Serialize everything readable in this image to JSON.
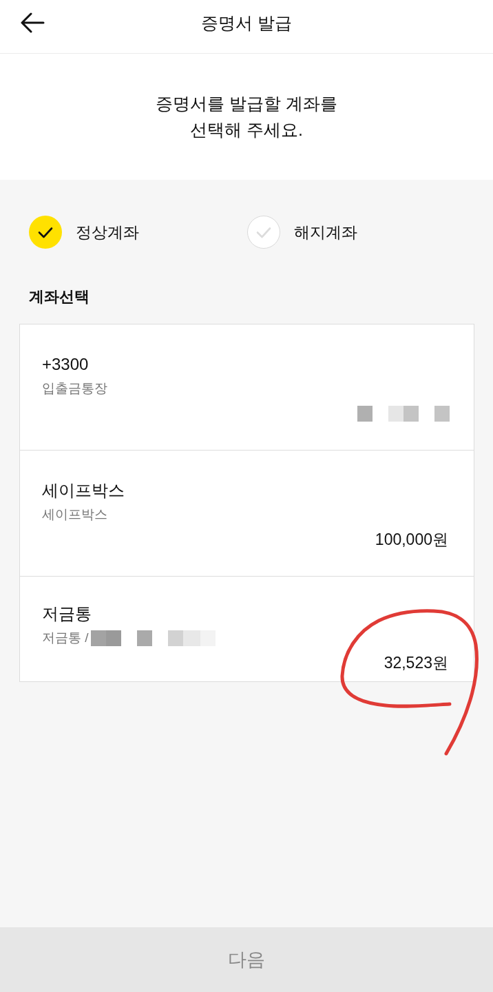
{
  "header": {
    "title": "증명서 발급"
  },
  "instruction": "증명서를 발급할 계좌를\n선택해 주세요.",
  "account_filter": [
    {
      "label": "정상계좌",
      "selected": true
    },
    {
      "label": "해지계좌",
      "selected": false
    }
  ],
  "section_label": "계좌선택",
  "accounts": [
    {
      "name": "+3300",
      "subtitle": "입출금통장",
      "subtitle_masked": false,
      "amount_masked": true,
      "highlighted": false
    },
    {
      "name": "세이프박스",
      "subtitle": "세이프박스",
      "subtitle_masked": false,
      "amount": "100,000원",
      "amount_masked": false,
      "highlighted": false
    },
    {
      "name": "저금통",
      "subtitle": "저금통 /",
      "subtitle_masked": true,
      "amount": "32,523원",
      "amount_masked": false,
      "highlighted": true
    }
  ],
  "next_button": {
    "label": "다음",
    "disabled": true
  }
}
